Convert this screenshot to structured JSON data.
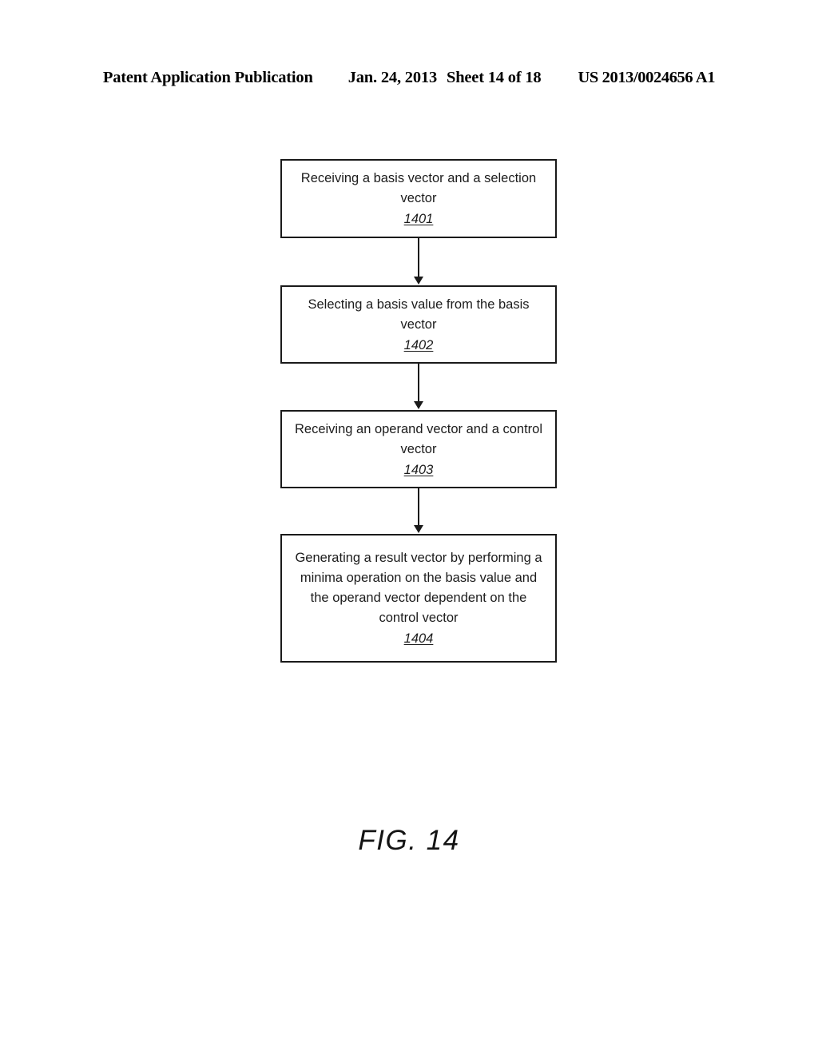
{
  "page": {
    "background_color": "#ffffff",
    "ink_color": "#1a1a1a"
  },
  "header": {
    "publication": "Patent Application Publication",
    "date": "Jan. 24, 2013",
    "sheet": "Sheet 14 of 18",
    "publication_number": "US 2013/0024656 A1"
  },
  "figure": {
    "caption": "FIG. 14",
    "type": "flowchart",
    "nodes": [
      {
        "id": "1401",
        "text": "Receiving a basis vector and a selection vector",
        "ref": "1401"
      },
      {
        "id": "1402",
        "text": "Selecting a basis value from the basis vector",
        "ref": "1402"
      },
      {
        "id": "1403",
        "text": "Receiving an operand vector and a control vector",
        "ref": "1403"
      },
      {
        "id": "1404",
        "text": "Generating a result vector by performing a minima operation on the basis value and the operand vector dependent on the control vector",
        "ref": "1404"
      }
    ],
    "connectors": [
      {
        "from": "1401",
        "to": "1402",
        "direction": "down"
      },
      {
        "from": "1402",
        "to": "1403",
        "direction": "down"
      },
      {
        "from": "1403",
        "to": "1404",
        "direction": "down"
      }
    ]
  }
}
